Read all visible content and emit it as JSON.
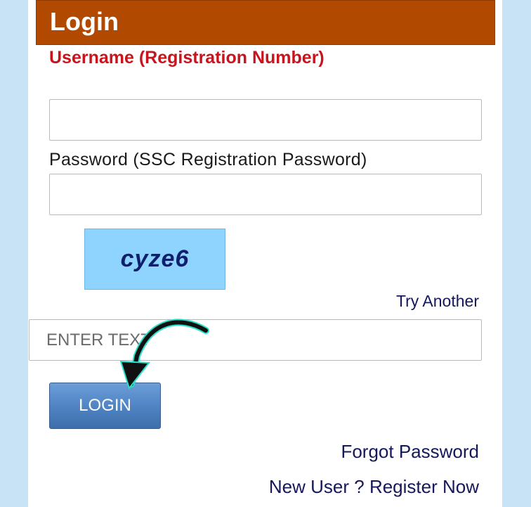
{
  "header": {
    "title": "Login"
  },
  "form": {
    "username_label": "Username (Registration Number)",
    "username_value": "",
    "password_label": "Password (SSC Registration Password)",
    "password_value": "",
    "captcha_text": "cyze6",
    "try_another": "Try Another",
    "captcha_placeholder": "ENTER TEXT",
    "login_label": "LOGIN"
  },
  "links": {
    "forgot_password": "Forgot Password",
    "register": "New User ? Register Now"
  },
  "colors": {
    "header_bg": "#b14900",
    "username_label": "#c8141c",
    "captcha_bg": "#8fd3ff",
    "captcha_text": "#0f1f6e",
    "login_button": "#4e82c2",
    "link_text": "#15185a",
    "page_bg": "#c9e3f6",
    "annotation_arrow": "#111111"
  }
}
